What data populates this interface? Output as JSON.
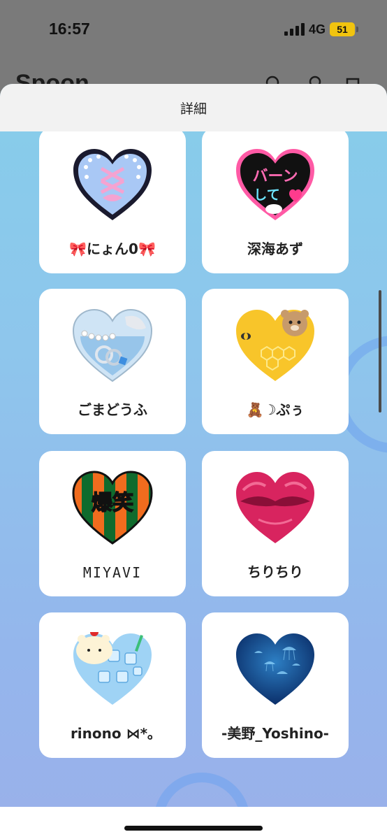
{
  "status_bar": {
    "time": "16:57",
    "network": "4G",
    "battery": "51"
  },
  "background_app": {
    "logo": "Spoon"
  },
  "sheet": {
    "title": "詳細"
  },
  "cards": [
    {
      "label": "🎀にょん0🎀",
      "heart": "lace-corset-heart-icon"
    },
    {
      "label": "深海あず",
      "heart": "bang-shite-heart-icon"
    },
    {
      "label": "ごまどうふ",
      "heart": "pearl-ring-heart-icon"
    },
    {
      "label": "🧸☽ぷぅ",
      "heart": "honey-bear-heart-icon"
    },
    {
      "label": "MIYAVI",
      "heart": "bakusho-striped-heart-icon"
    },
    {
      "label": "ちりちり",
      "heart": "lips-heart-icon"
    },
    {
      "label": "rinono ⋈*｡",
      "heart": "soda-bear-heart-icon"
    },
    {
      "label": "-美野_Yoshino-",
      "heart": "jellyfish-heart-icon"
    }
  ],
  "heart_texts": {
    "bakusho": "爆笑",
    "bang_line1": "バーン",
    "bang_line2": "して"
  },
  "colors": {
    "sheet_gradient_top": "#86cdea",
    "sheet_gradient_bottom": "#9ab0ea",
    "battery": "#f1c40f"
  }
}
